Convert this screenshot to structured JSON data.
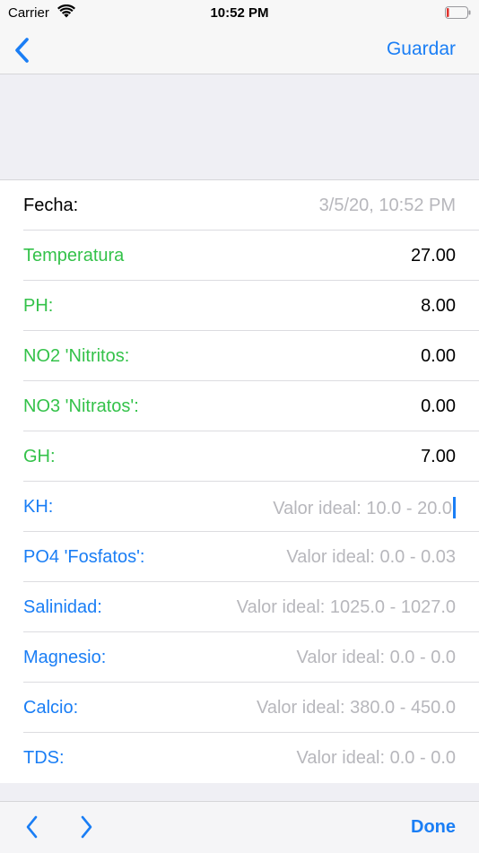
{
  "status_bar": {
    "carrier": "Carrier",
    "time": "10:52 PM"
  },
  "nav": {
    "back_icon": "chevron-left-icon",
    "save_label": "Guardar"
  },
  "form": {
    "rows": [
      {
        "label": "Fecha:",
        "value": "3/5/20, 10:52 PM"
      },
      {
        "label": "Temperatura",
        "value": "27.00"
      },
      {
        "label": "PH:",
        "value": "8.00"
      },
      {
        "label": "NO2 'Nitritos:",
        "value": "0.00"
      },
      {
        "label": "NO3 'Nitratos':",
        "value": "0.00"
      },
      {
        "label": "GH:",
        "value": "7.00"
      },
      {
        "label": "KH:",
        "placeholder": "Valor ideal:  10.0 - 20.0"
      },
      {
        "label": "PO4 'Fosfatos':",
        "placeholder": "Valor ideal:  0.0 - 0.03"
      },
      {
        "label": "Salinidad:",
        "placeholder": "Valor ideal:  1025.0 - 1027.0"
      },
      {
        "label": "Magnesio:",
        "placeholder": "Valor ideal:  0.0 - 0.0"
      },
      {
        "label": "Calcio:",
        "placeholder": "Valor ideal:  380.0 - 450.0"
      },
      {
        "label": "TDS:",
        "placeholder": "Valor ideal:  0.0 - 0.0"
      }
    ]
  },
  "toolbar": {
    "prev_icon": "chevron-left-icon",
    "next_icon": "chevron-right-icon",
    "done_label": "Done"
  },
  "colors": {
    "accent": "#1a7ef5",
    "filled_label": "#34c24a",
    "placeholder": "#b7b7bc"
  }
}
